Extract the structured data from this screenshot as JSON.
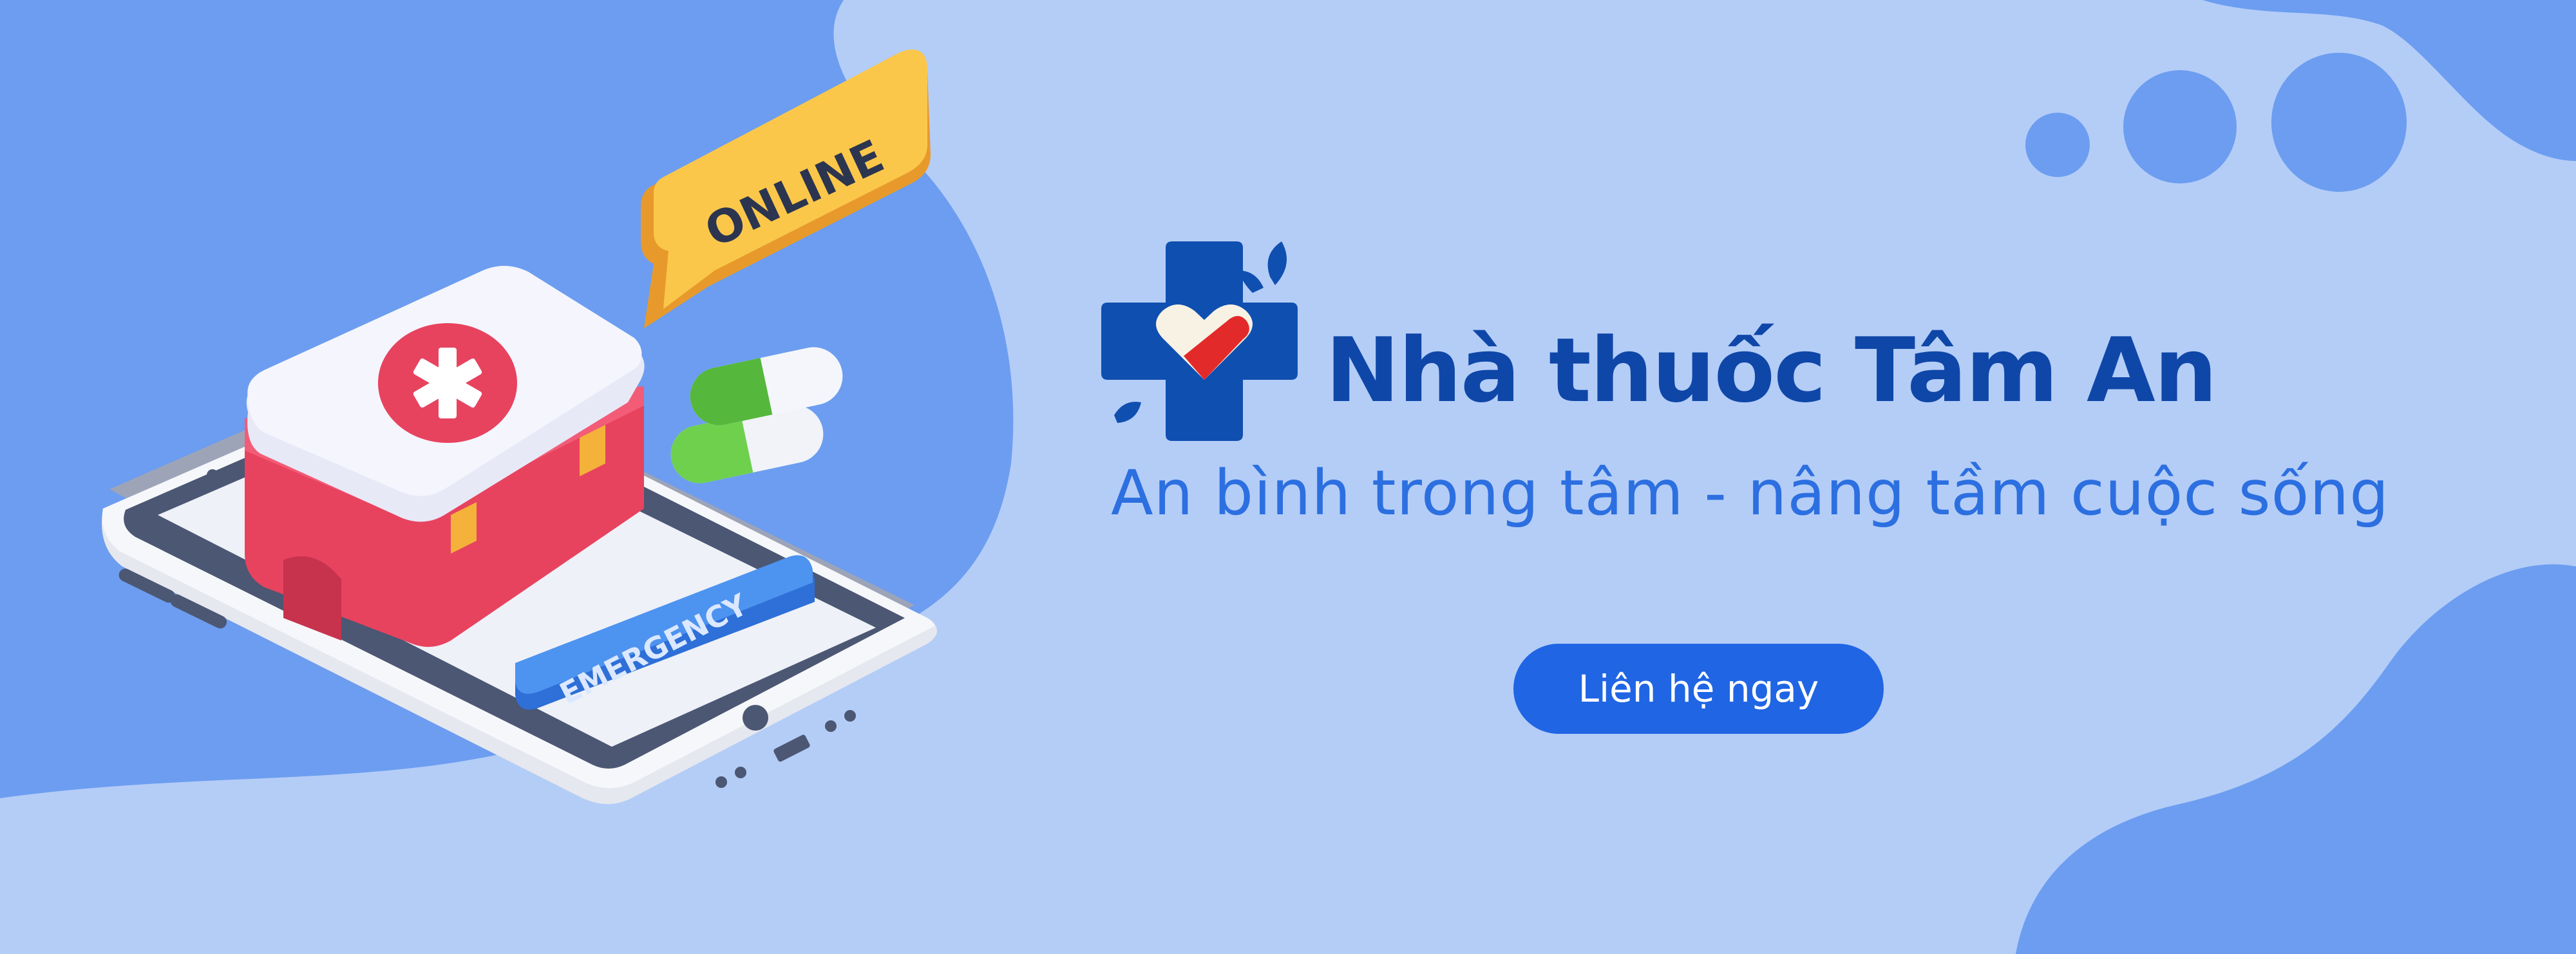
{
  "colors": {
    "background": "#b4cdf7",
    "blob": "#6c9df0",
    "brand_text": "#0f47a8",
    "slogan_text": "#2c6fe0",
    "button": "#2065e4",
    "button_text": "#ffffff",
    "logo_cross": "#0f4fb0",
    "logo_heart_red": "#e32a2a"
  },
  "brand": {
    "name": "Nhà thuốc Tâm An",
    "slogan": "An bình trong tâm - nâng tầm cuộc sống",
    "logo_icon": "medical-cross-heart-logo"
  },
  "cta": {
    "label": "Liên hệ ngay"
  },
  "illustration": {
    "speech_bubble": "ONLINE",
    "phone_button": "EMERGENCY",
    "icons": [
      "smartphone-icon",
      "first-aid-kit-icon",
      "capsule-icon",
      "speech-bubble-icon"
    ]
  }
}
